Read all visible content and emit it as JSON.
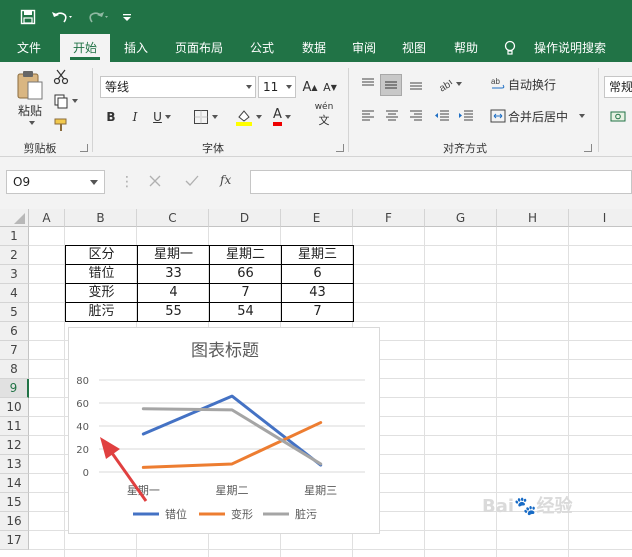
{
  "colors": {
    "excel_green": "#217346",
    "series_1": "#4472c4",
    "series_2": "#ed7d31",
    "series_3": "#a5a5a5",
    "arrow": "#e04040"
  },
  "quick_access": {
    "save_icon": "save-icon",
    "undo_icon": "undo-icon",
    "redo_icon": "redo-icon",
    "customize_icon": "customize-icon"
  },
  "tabs": [
    "文件",
    "开始",
    "插入",
    "页面布局",
    "公式",
    "数据",
    "审阅",
    "视图",
    "帮助"
  ],
  "tell_me": "操作说明搜索",
  "ribbon": {
    "paste_label": "粘贴",
    "clipboard_label": "剪贴板",
    "font_name": "等线",
    "font_size": "11",
    "bold": "B",
    "italic": "I",
    "underline": "U",
    "font_color_letter": "A",
    "phonetic": "wén",
    "font_group_label": "字体",
    "wrap_text": "自动换行",
    "merge_center": "合并后居中",
    "align_group_label": "对齐方式",
    "number_format": "常规"
  },
  "formula_bar": {
    "name_box": "O9",
    "fx": "fx",
    "formula": ""
  },
  "sheet": {
    "columns": [
      "A",
      "B",
      "C",
      "D",
      "E",
      "F",
      "G",
      "H",
      "I"
    ],
    "rows": [
      "1",
      "2",
      "3",
      "4",
      "5",
      "6",
      "7",
      "8",
      "9",
      "10",
      "11",
      "12",
      "13",
      "14",
      "15",
      "16",
      "17"
    ],
    "selected_row": "9",
    "table": [
      [
        "区分",
        "星期一",
        "星期二",
        "星期三"
      ],
      [
        "错位",
        "33",
        "66",
        "6"
      ],
      [
        "变形",
        "4",
        "7",
        "43"
      ],
      [
        "脏污",
        "55",
        "54",
        "7"
      ]
    ]
  },
  "chart_data": {
    "type": "line",
    "title": "图表标题",
    "categories": [
      "星期一",
      "星期二",
      "星期三"
    ],
    "series": [
      {
        "name": "错位",
        "values": [
          33,
          66,
          6
        ]
      },
      {
        "name": "变形",
        "values": [
          4,
          7,
          43
        ]
      },
      {
        "name": "脏污",
        "values": [
          55,
          54,
          7
        ]
      }
    ],
    "yticks": [
      "0",
      "20",
      "40",
      "60",
      "80"
    ],
    "ylim": [
      0,
      80
    ],
    "grid": true,
    "legend": "bottom"
  }
}
